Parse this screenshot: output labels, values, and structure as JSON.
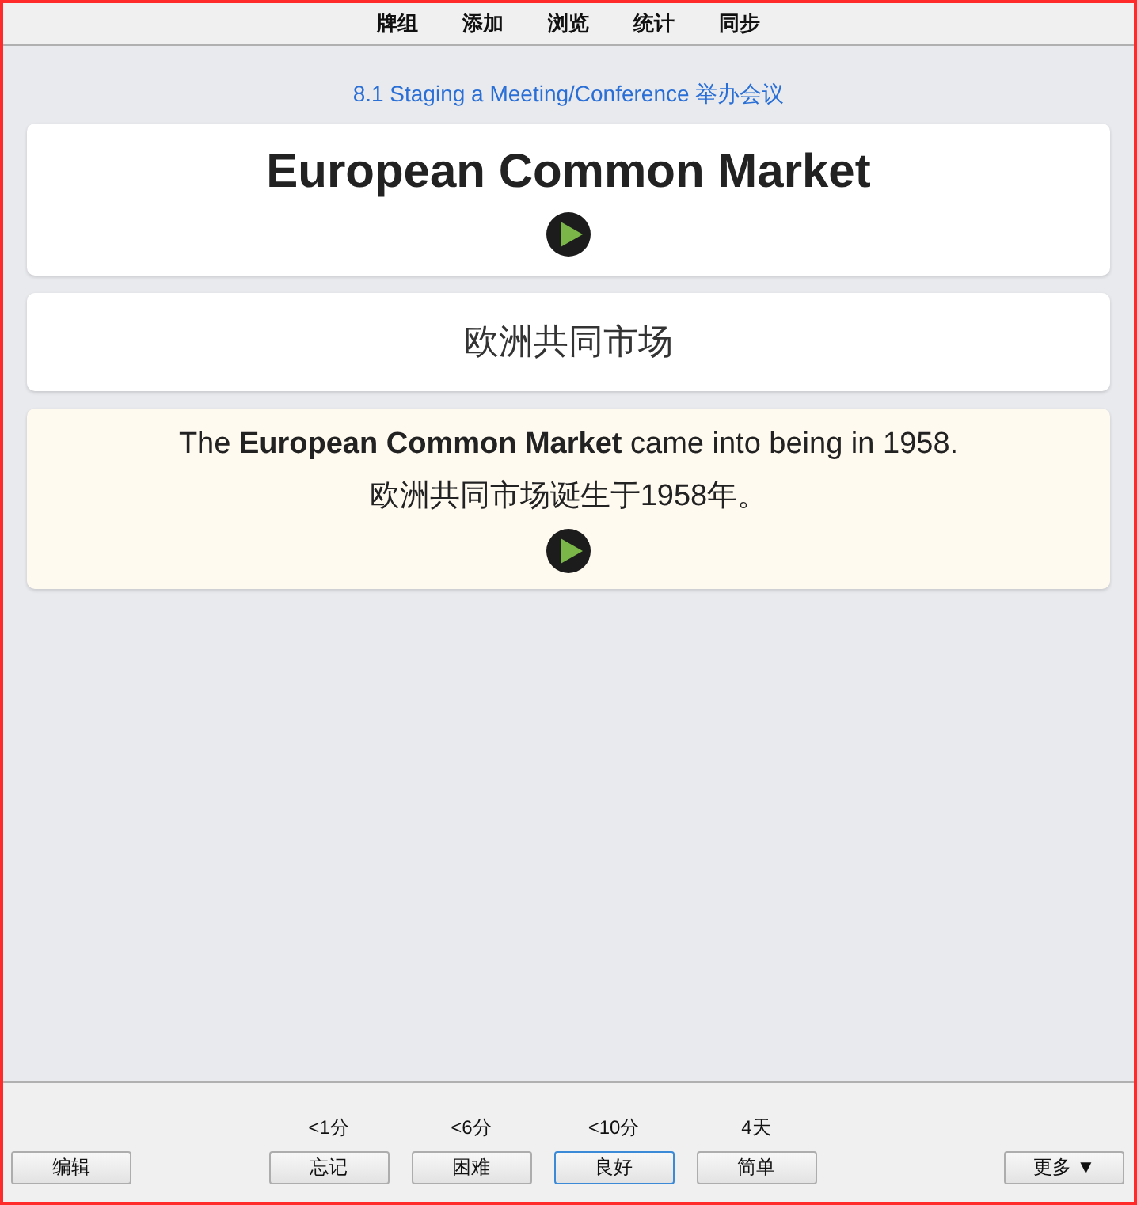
{
  "toolbar": {
    "items": [
      {
        "label": "牌组"
      },
      {
        "label": "添加"
      },
      {
        "label": "浏览"
      },
      {
        "label": "统计"
      },
      {
        "label": "同步"
      }
    ]
  },
  "deck_path": "8.1 Staging a Meeting/Conference 举办会议",
  "front": {
    "term": "European Common Market",
    "audio": true
  },
  "back": {
    "translation": "欧洲共同市场"
  },
  "example": {
    "sentence": "The **European Common Market** came into being in 1958.",
    "translation": "欧洲共同市场诞生于1958年。",
    "audio": true
  },
  "bottom_bar": {
    "edit_button": "编辑",
    "more_button": "更多 ▼",
    "answers": [
      {
        "interval": "<1分",
        "label": "忘记",
        "selected": false
      },
      {
        "interval": "<6分",
        "label": "困难",
        "selected": false
      },
      {
        "interval": "<10分",
        "label": "良好",
        "selected": true
      },
      {
        "interval": "4天",
        "label": "简单",
        "selected": false
      }
    ]
  }
}
